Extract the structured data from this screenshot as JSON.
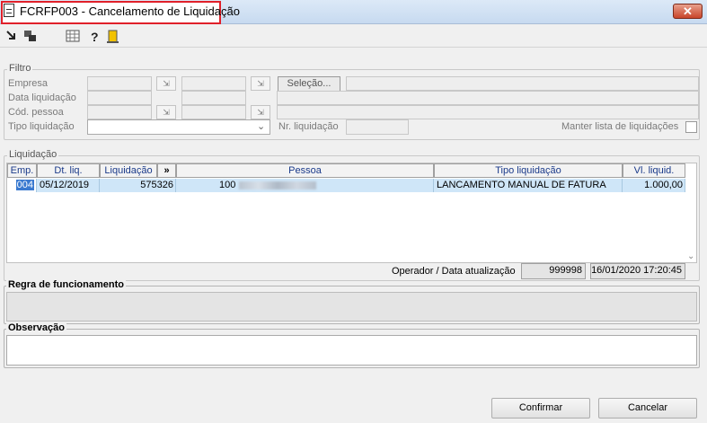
{
  "window": {
    "title": "FCRFP003 - Cancelamento de Liquidação",
    "close_glyph": "✕"
  },
  "toolbar": {
    "icons": [
      "exit-icon",
      "copy-window-icon",
      "calendar-grid-icon",
      "help-icon",
      "door-icon"
    ]
  },
  "filter": {
    "legend": "Filtro",
    "empresa_label": "Empresa",
    "data_liquidacao_label": "Data liquidação",
    "cod_pessoa_label": "Cód. pessoa",
    "tipo_liquidacao_label": "Tipo liquidação",
    "nr_liquidacao_label": "Nr. liquidação",
    "selecao_label": "Seleção...",
    "manter_lista_label": "Manter lista de liquidações",
    "dropdown_glyph": "⌄"
  },
  "liquidacao": {
    "legend": "Liquidação",
    "columns": [
      "Emp.",
      "Dt. liq.",
      "Liquidação",
      "»",
      "Pessoa",
      "Tipo liquidação",
      "Vl. liquid."
    ],
    "rows": [
      {
        "emp": "004",
        "dt_liq": "05/12/2019",
        "liquidacao": "575326",
        "pessoa_code": "100",
        "tipo_liquidacao": "LANCAMENTO MANUAL DE FATURA",
        "vl_liquid": "1.000,00"
      }
    ]
  },
  "operador": {
    "label": "Operador / Data atualização",
    "operator": "999998",
    "datetime": "16/01/2020 17:20:45"
  },
  "regra": {
    "legend": "Regra de funcionamento"
  },
  "observacao": {
    "legend": "Observação"
  },
  "buttons": {
    "confirmar": "Confirmar",
    "cancelar": "Cancelar"
  }
}
